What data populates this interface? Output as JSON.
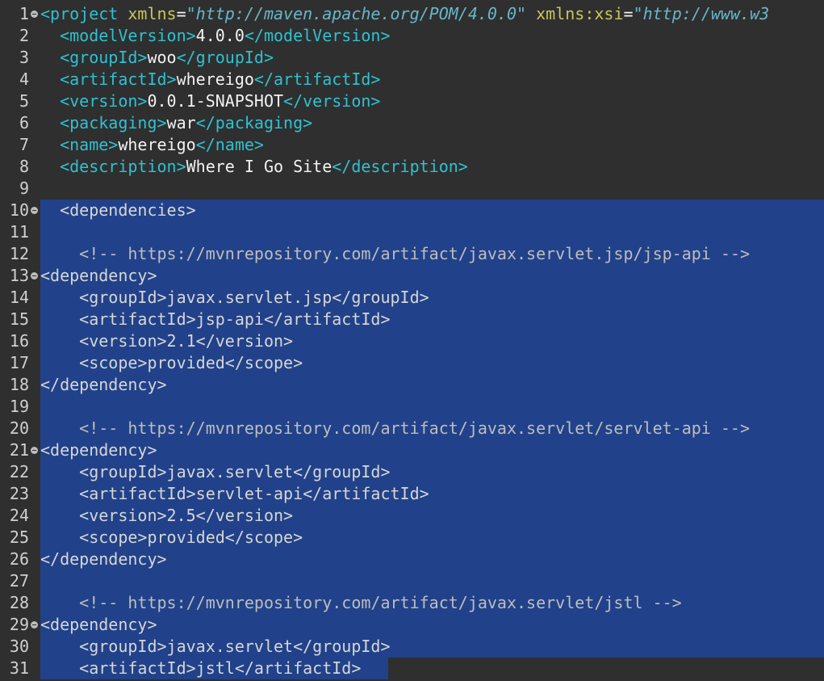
{
  "colors": {
    "background": "#2f2f2f",
    "selection": "#21428a",
    "tag": "#2fc1d1",
    "attribute": "#c9c65d",
    "attribute_value": "#67b7c9",
    "text": "#f2f2f2"
  },
  "lines": [
    {
      "number": "1",
      "fold": true,
      "selected": false,
      "indent": "",
      "tokens": [
        [
          "tag",
          "<project"
        ],
        [
          "text",
          " "
        ],
        [
          "attr",
          "xmlns"
        ],
        [
          "text",
          "="
        ],
        [
          "val",
          "\"http://maven.apache.org/POM/4.0.0\""
        ],
        [
          "text",
          " "
        ],
        [
          "attr",
          "xmlns:xsi"
        ],
        [
          "text",
          "="
        ],
        [
          "val",
          "\"http://www.w3"
        ]
      ]
    },
    {
      "number": "2",
      "fold": false,
      "selected": false,
      "indent": "  ",
      "tokens": [
        [
          "tag",
          "<modelVersion>"
        ],
        [
          "text",
          "4.0.0"
        ],
        [
          "tag",
          "</modelVersion>"
        ]
      ]
    },
    {
      "number": "3",
      "fold": false,
      "selected": false,
      "indent": "  ",
      "tokens": [
        [
          "tag",
          "<groupId>"
        ],
        [
          "text",
          "woo"
        ],
        [
          "tag",
          "</groupId>"
        ]
      ]
    },
    {
      "number": "4",
      "fold": false,
      "selected": false,
      "indent": "  ",
      "tokens": [
        [
          "tag",
          "<artifactId>"
        ],
        [
          "text",
          "whereigo"
        ],
        [
          "tag",
          "</artifactId>"
        ]
      ]
    },
    {
      "number": "5",
      "fold": false,
      "selected": false,
      "indent": "  ",
      "tokens": [
        [
          "tag",
          "<version>"
        ],
        [
          "text",
          "0.0.1-SNAPSHOT"
        ],
        [
          "tag",
          "</version>"
        ]
      ]
    },
    {
      "number": "6",
      "fold": false,
      "selected": false,
      "indent": "  ",
      "tokens": [
        [
          "tag",
          "<packaging>"
        ],
        [
          "text",
          "war"
        ],
        [
          "tag",
          "</packaging>"
        ]
      ]
    },
    {
      "number": "7",
      "fold": false,
      "selected": false,
      "indent": "  ",
      "tokens": [
        [
          "tag",
          "<name>"
        ],
        [
          "text",
          "whereigo"
        ],
        [
          "tag",
          "</name>"
        ]
      ]
    },
    {
      "number": "8",
      "fold": false,
      "selected": false,
      "indent": "  ",
      "tokens": [
        [
          "tag",
          "<description>"
        ],
        [
          "text",
          "Where I Go Site"
        ],
        [
          "tag",
          "</description>"
        ]
      ]
    },
    {
      "number": "9",
      "fold": false,
      "selected": false,
      "indent": "",
      "tokens": []
    },
    {
      "number": "10",
      "fold": true,
      "selected": true,
      "indent": "  ",
      "tokens": [
        [
          "tag",
          "<dependencies>"
        ]
      ]
    },
    {
      "number": "11",
      "fold": false,
      "selected": true,
      "indent": "",
      "tokens": []
    },
    {
      "number": "12",
      "fold": false,
      "selected": true,
      "indent": "    ",
      "tokens": [
        [
          "cmt",
          "<!-- https://mvnrepository.com/artifact/javax.servlet.jsp/jsp-api -->"
        ]
      ]
    },
    {
      "number": "13",
      "fold": true,
      "selected": true,
      "indent": "",
      "tokens": [
        [
          "tag",
          "<dependency>"
        ]
      ]
    },
    {
      "number": "14",
      "fold": false,
      "selected": true,
      "indent": "    ",
      "tokens": [
        [
          "tag",
          "<groupId>"
        ],
        [
          "text",
          "javax.servlet.jsp"
        ],
        [
          "tag",
          "</groupId>"
        ]
      ]
    },
    {
      "number": "15",
      "fold": false,
      "selected": true,
      "indent": "    ",
      "tokens": [
        [
          "tag",
          "<artifactId>"
        ],
        [
          "text",
          "jsp-api"
        ],
        [
          "tag",
          "</artifactId>"
        ]
      ]
    },
    {
      "number": "16",
      "fold": false,
      "selected": true,
      "indent": "    ",
      "tokens": [
        [
          "tag",
          "<version>"
        ],
        [
          "text",
          "2.1"
        ],
        [
          "tag",
          "</version>"
        ]
      ]
    },
    {
      "number": "17",
      "fold": false,
      "selected": true,
      "indent": "    ",
      "tokens": [
        [
          "tag",
          "<scope>"
        ],
        [
          "text",
          "provided"
        ],
        [
          "tag",
          "</scope>"
        ]
      ]
    },
    {
      "number": "18",
      "fold": false,
      "selected": true,
      "indent": "",
      "tokens": [
        [
          "tag",
          "</dependency>"
        ]
      ]
    },
    {
      "number": "19",
      "fold": false,
      "selected": true,
      "indent": "",
      "tokens": []
    },
    {
      "number": "20",
      "fold": false,
      "selected": true,
      "indent": "    ",
      "tokens": [
        [
          "cmt",
          "<!-- https://mvnrepository.com/artifact/javax.servlet/servlet-api -->"
        ]
      ]
    },
    {
      "number": "21",
      "fold": true,
      "selected": true,
      "indent": "",
      "tokens": [
        [
          "tag",
          "<dependency>"
        ]
      ]
    },
    {
      "number": "22",
      "fold": false,
      "selected": true,
      "indent": "    ",
      "tokens": [
        [
          "tag",
          "<groupId>"
        ],
        [
          "text",
          "javax.servlet"
        ],
        [
          "tag",
          "</groupId>"
        ]
      ]
    },
    {
      "number": "23",
      "fold": false,
      "selected": true,
      "indent": "    ",
      "tokens": [
        [
          "tag",
          "<artifactId>"
        ],
        [
          "text",
          "servlet-api"
        ],
        [
          "tag",
          "</artifactId>"
        ]
      ]
    },
    {
      "number": "24",
      "fold": false,
      "selected": true,
      "indent": "    ",
      "tokens": [
        [
          "tag",
          "<version>"
        ],
        [
          "text",
          "2.5"
        ],
        [
          "tag",
          "</version>"
        ]
      ]
    },
    {
      "number": "25",
      "fold": false,
      "selected": true,
      "indent": "    ",
      "tokens": [
        [
          "tag",
          "<scope>"
        ],
        [
          "text",
          "provided"
        ],
        [
          "tag",
          "</scope>"
        ]
      ]
    },
    {
      "number": "26",
      "fold": false,
      "selected": true,
      "indent": "",
      "tokens": [
        [
          "tag",
          "</dependency>"
        ]
      ]
    },
    {
      "number": "27",
      "fold": false,
      "selected": true,
      "indent": "",
      "tokens": []
    },
    {
      "number": "28",
      "fold": false,
      "selected": true,
      "indent": "    ",
      "tokens": [
        [
          "cmt",
          "<!-- https://mvnrepository.com/artifact/javax.servlet/jstl -->"
        ]
      ]
    },
    {
      "number": "29",
      "fold": true,
      "selected": true,
      "indent": "",
      "tokens": [
        [
          "tag",
          "<dependency>"
        ]
      ]
    },
    {
      "number": "30",
      "fold": false,
      "selected": true,
      "indent": "    ",
      "tokens": [
        [
          "tag",
          "<groupId>"
        ],
        [
          "text",
          "javax.servlet"
        ],
        [
          "tag",
          "</groupId>"
        ]
      ]
    },
    {
      "number": "31",
      "fold": false,
      "selected": true,
      "selection_ends_at_text": true,
      "indent": "    ",
      "tokens": [
        [
          "tag",
          "<artifactId>"
        ],
        [
          "text",
          "jstl"
        ],
        [
          "tag",
          "</artifactId>"
        ]
      ]
    }
  ]
}
